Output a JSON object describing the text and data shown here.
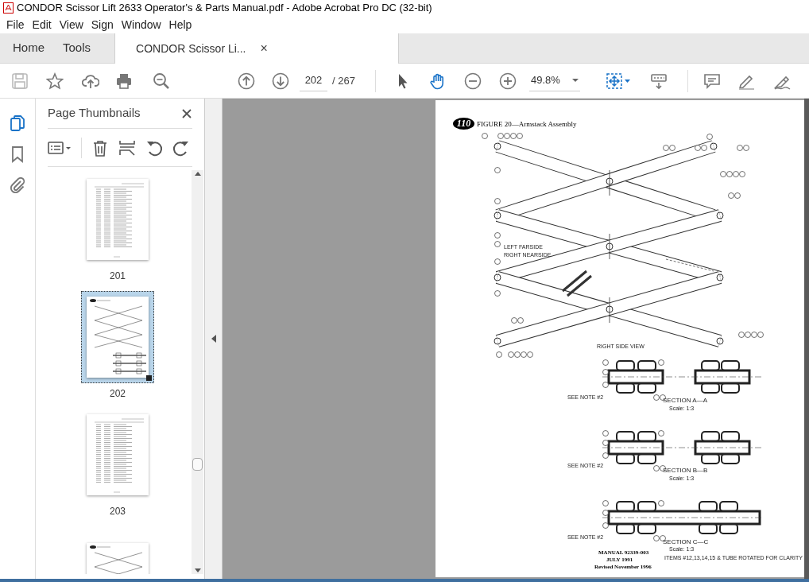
{
  "window": {
    "title": "CONDOR Scissor Lift 2633 Operator's & Parts Manual.pdf - Adobe Acrobat Pro DC (32-bit)"
  },
  "menu": [
    "File",
    "Edit",
    "View",
    "Sign",
    "Window",
    "Help"
  ],
  "tabs": [
    {
      "label": "Home",
      "selected": false,
      "kind": "nav"
    },
    {
      "label": "Tools",
      "selected": false,
      "kind": "nav"
    },
    {
      "label": "CONDOR Scissor Li...",
      "selected": true,
      "kind": "document"
    }
  ],
  "close_tab": "×",
  "toolbar": {
    "page_number": "202",
    "page_count": "/ 267",
    "zoom": "49.8%"
  },
  "side_rail": [
    {
      "kind": "pages",
      "selected": true
    },
    {
      "kind": "bookmark",
      "selected": false
    },
    {
      "kind": "attachment",
      "selected": false
    }
  ],
  "panel": {
    "title": "Page Thumbnails",
    "thumbnails": [
      {
        "label": "201",
        "selected": false,
        "kind": "table"
      },
      {
        "label": "202",
        "selected": true,
        "kind": "drawing"
      },
      {
        "label": "203",
        "selected": false,
        "kind": "table"
      },
      {
        "selected": false,
        "kind": "drawing"
      }
    ]
  },
  "document": {
    "figure_number": "110",
    "figure_title": "FIGURE 20—Armstack Assembly",
    "labels": [
      "LEFT FARSIDE",
      "RIGHT NEARSIDE",
      "RIGHT SIDE VIEW",
      "SEE NOTE #2",
      "SECTION A—A",
      "Scale: 1:3",
      "SEE NOTE #2",
      "SECTION B—B",
      "Scale: 1:3",
      "SEE NOTE #2",
      "SECTION C—C",
      "Scale: 1:3",
      "ITEMS #12,13,14,15 & TUBE ROTATED FOR CLARITY"
    ],
    "footer": [
      "MANUAL 92339-003",
      "JULY 1991",
      "Revised November 1996"
    ]
  }
}
